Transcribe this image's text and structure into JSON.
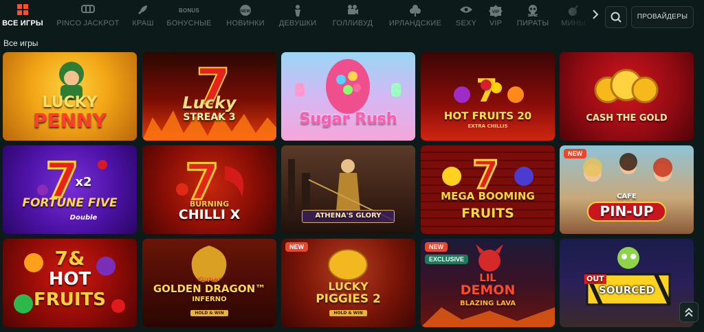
{
  "nav": {
    "categories": [
      {
        "label": "ВСЕ ИГРЫ",
        "icon": "grid-icon",
        "active": true
      },
      {
        "label": "PINCO JACKPOT",
        "icon": "jackpot-icon"
      },
      {
        "label": "КРАШ",
        "icon": "rocket-icon"
      },
      {
        "label": "БОНУСНЫЕ",
        "icon": "bonus-icon",
        "icon_text": "BONUS"
      },
      {
        "label": "НОВИНКИ",
        "icon": "new-icon",
        "icon_text": "NEW"
      },
      {
        "label": "ДЕВУШКИ",
        "icon": "girl-icon"
      },
      {
        "label": "ГОЛЛИВУД",
        "icon": "camera-icon"
      },
      {
        "label": "ИРЛАНДСКИЕ",
        "icon": "clover-icon"
      },
      {
        "label": "SEXY",
        "icon": "eye-icon"
      },
      {
        "label": "VIP",
        "icon": "vip-icon",
        "icon_text": "VIP"
      },
      {
        "label": "ПИРАТЫ",
        "icon": "skull-icon"
      },
      {
        "label": "МИНЫ",
        "icon": "bomb-icon"
      }
    ],
    "providers_label": "ПРОВАЙДЕРЫ"
  },
  "section_title": "Все игры",
  "games": [
    {
      "name": "LUCKY PENNY",
      "line1": "LUCKY",
      "line2": "PENNY"
    },
    {
      "name": "Lucky Streak 3",
      "line1": "Lucky",
      "line2": "STREAK 3"
    },
    {
      "name": "Sugar Rush",
      "line1": "Sugar Rush"
    },
    {
      "name": "HOT FRUITS 20 EXTRA CHILLIS",
      "line1": "HOT FRUITS 20",
      "line2": "EXTRA CHILLIS"
    },
    {
      "name": "CASH THE GOLD",
      "line1": "CASH THE GOLD"
    },
    {
      "name": "FORTUNE FIVE Double",
      "line1": "x2",
      "line2": "FORTUNE FIVE",
      "line3": "Double"
    },
    {
      "name": "Burning Chilli X",
      "line1": "BURNING",
      "line2": "CHILLI X"
    },
    {
      "name": "ATHENA'S GLORY",
      "line1": "ATHENA'S GLORY"
    },
    {
      "name": "MEGA BOOMING FRUITS",
      "line1": "MEGA BOOMING",
      "line2": "FRUITS"
    },
    {
      "name": "CAFE PIN-UP",
      "line1": "CAFE",
      "line2": "PIN-UP",
      "badge": "NEW"
    },
    {
      "name": "7 & HOT FRUITS",
      "line1": "7&",
      "line2": "HOT",
      "line3": "FRUITS"
    },
    {
      "name": "SUPER GOLDEN DRAGON INFERNO",
      "line1": "Super",
      "line2": "GOLDEN DRAGON™",
      "line3": "INFERNO",
      "tag": "HOLD & WIN"
    },
    {
      "name": "LUCKY PIGGIES 2",
      "line1": "LUCKY",
      "line2": "PIGGIES 2",
      "tag": "HOLD & WIN",
      "badge": "NEW"
    },
    {
      "name": "LIL DEMON BLAZING LAVA",
      "line1": "LIL",
      "line2": "DEMON",
      "line3": "BLAZING LAVA",
      "badge": "NEW",
      "badge2": "EXCLUSIVE"
    },
    {
      "name": "OUT SOURCED",
      "line1": "OUT",
      "line2": "SOURCED"
    }
  ]
}
